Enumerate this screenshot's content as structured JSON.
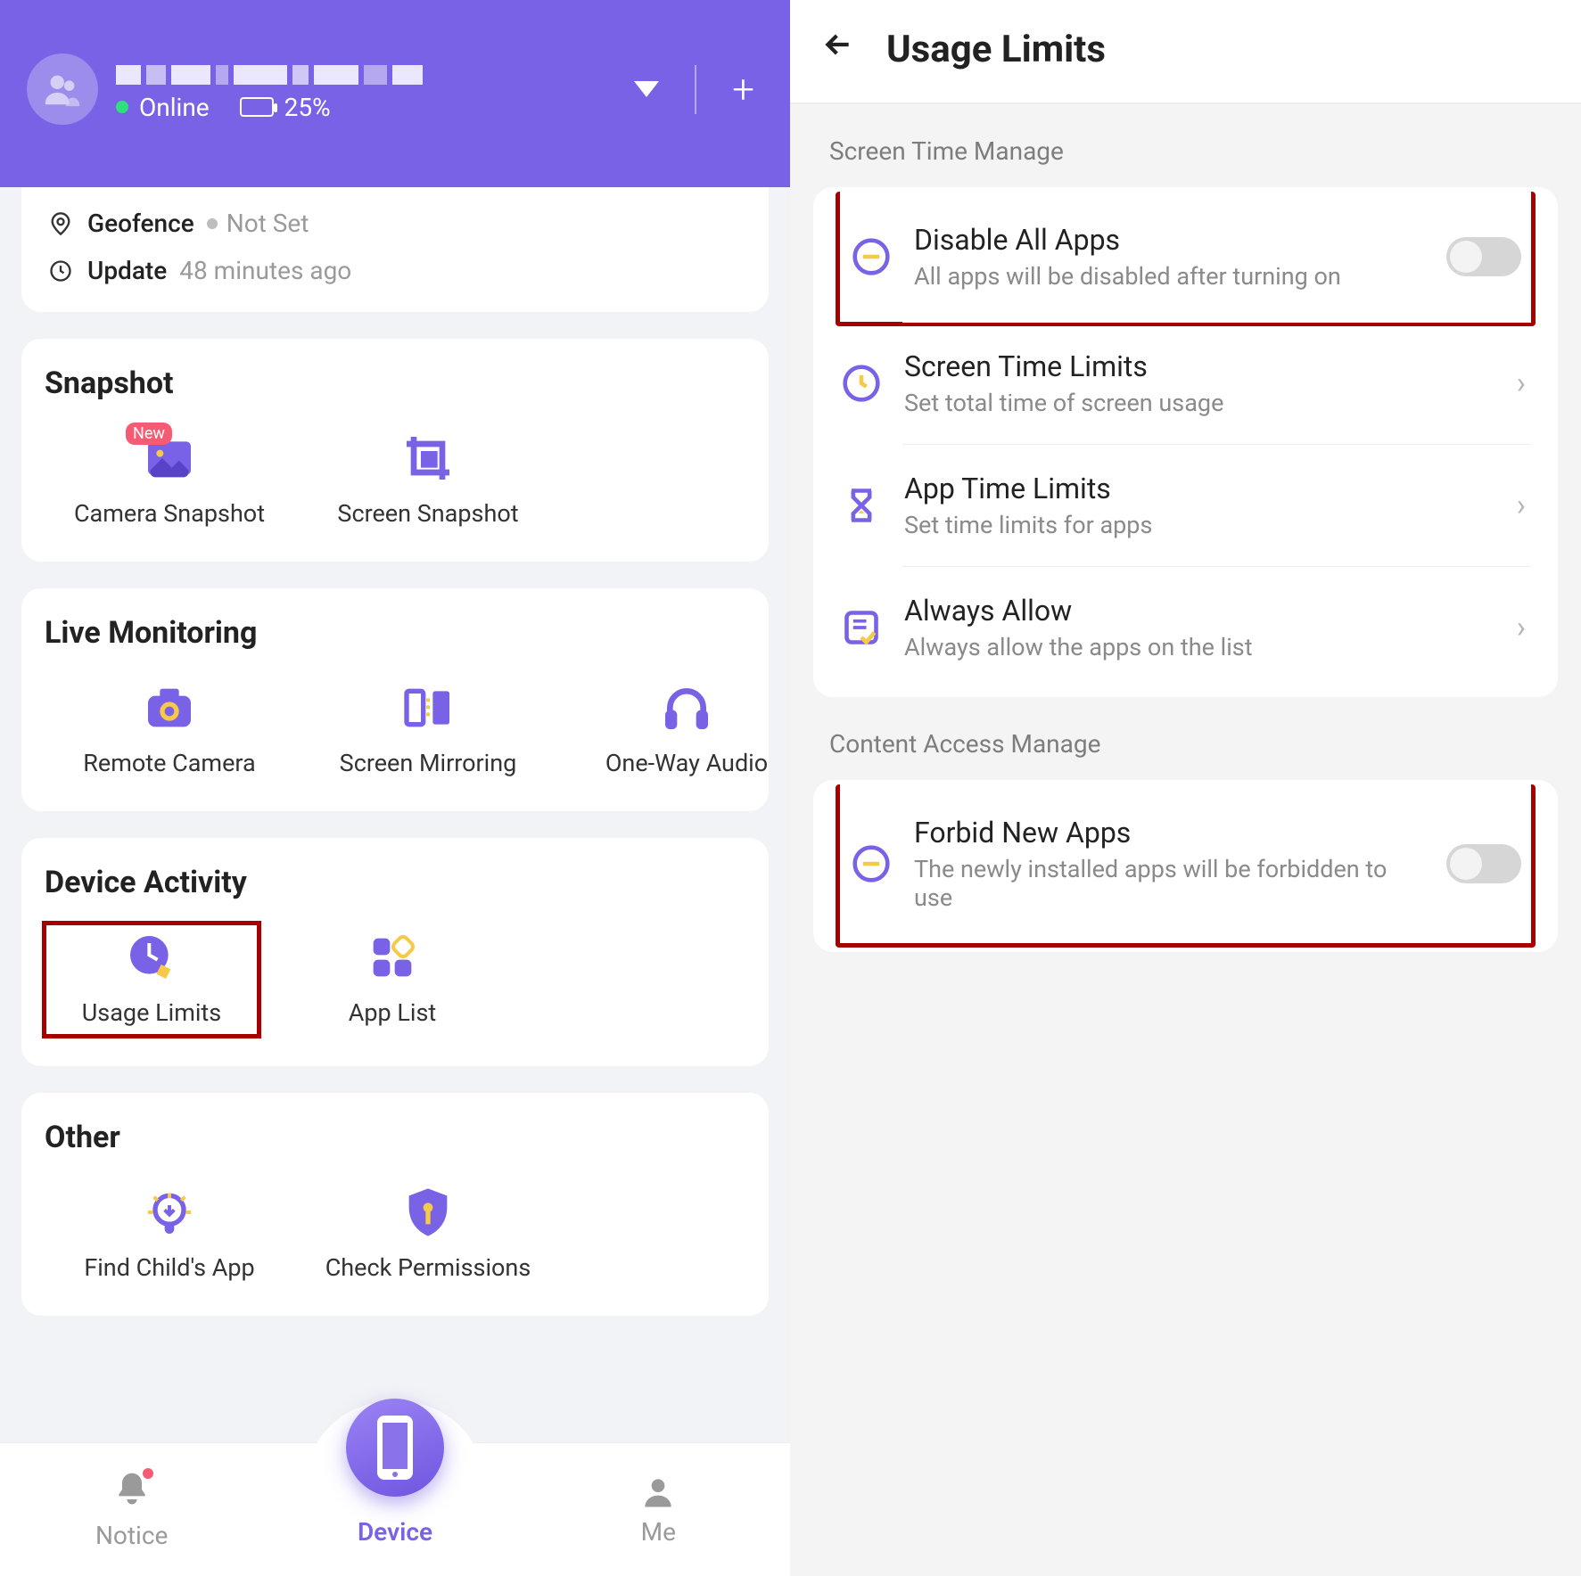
{
  "header": {
    "status_online": "Online",
    "battery_pct": "25%"
  },
  "info": {
    "geofence_label": "Geofence",
    "geofence_value": "Not Set",
    "update_label": "Update",
    "update_value": "48 minutes ago"
  },
  "sections": {
    "snapshot": {
      "title": "Snapshot",
      "tiles": [
        {
          "label": "Camera Snapshot",
          "badge": "New"
        },
        {
          "label": "Screen Snapshot"
        }
      ]
    },
    "live": {
      "title": "Live Monitoring",
      "tiles": [
        {
          "label": "Remote Camera"
        },
        {
          "label": "Screen Mirroring"
        },
        {
          "label": "One-Way Audio"
        }
      ]
    },
    "device": {
      "title": "Device Activity",
      "tiles": [
        {
          "label": "Usage Limits"
        },
        {
          "label": "App List"
        }
      ]
    },
    "other": {
      "title": "Other",
      "tiles": [
        {
          "label": "Find Child's App"
        },
        {
          "label": "Check Permissions"
        }
      ]
    }
  },
  "nav": {
    "notice": "Notice",
    "device": "Device",
    "me": "Me"
  },
  "right": {
    "title": "Usage Limits",
    "section1": "Screen Time Manage",
    "rows1": {
      "disable": {
        "t": "Disable All Apps",
        "d": "All apps will be disabled after turning on"
      },
      "stl": {
        "t": "Screen Time Limits",
        "d": "Set total time of screen usage"
      },
      "atl": {
        "t": "App Time Limits",
        "d": "Set time limits for apps"
      },
      "allow": {
        "t": "Always Allow",
        "d": "Always allow the apps on the list"
      }
    },
    "section2": "Content Access Manage",
    "rows2": {
      "forbid": {
        "t": "Forbid New Apps",
        "d": "The newly installed apps will be forbidden to use"
      }
    }
  },
  "colors": {
    "accent": "#7a62e6",
    "highlight": "#a60000"
  }
}
